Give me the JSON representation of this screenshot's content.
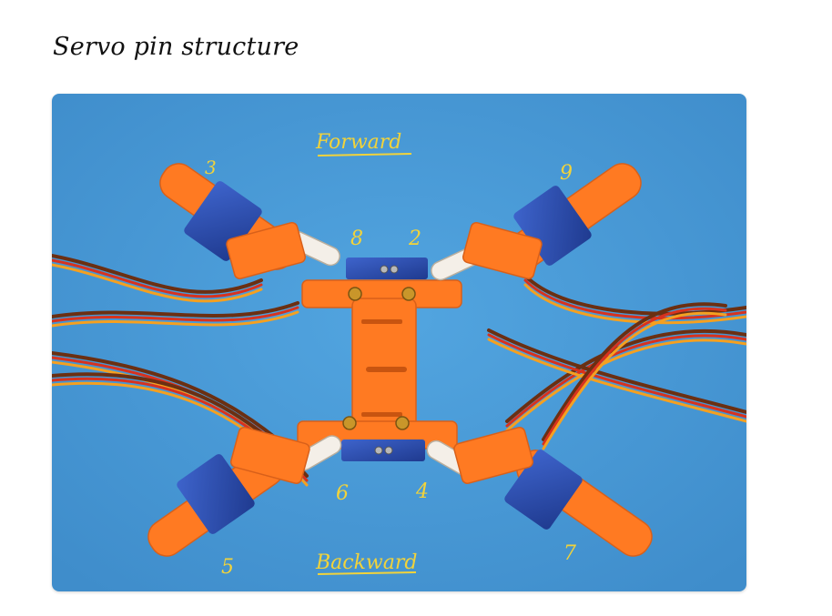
{
  "page": {
    "title": "Servo pin structure"
  },
  "photo": {
    "direction_labels": {
      "forward": "Forward",
      "backward": "Backward"
    },
    "pin_numbers": {
      "front_left_outer": "3",
      "front_left_inner": "8",
      "front_right_inner": "2",
      "front_right_outer": "9",
      "rear_left_outer": "5",
      "rear_left_inner": "6",
      "rear_right_inner": "4",
      "rear_right_outer": "7"
    },
    "colors": {
      "mat_blue": "#4a9bd8",
      "frame_orange": "#ff7a22",
      "servo_blue": "#2f4fb3",
      "label_yellow": "#f2d33a",
      "wire_brown": "#6b2f12",
      "wire_red": "#d8321e",
      "wire_orange": "#f5a020"
    }
  }
}
